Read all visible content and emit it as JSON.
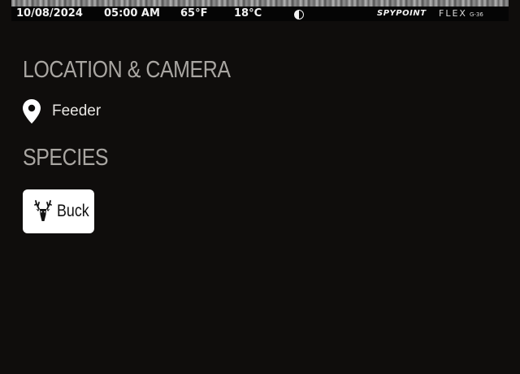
{
  "photo_stamp": {
    "date": "10/08/2024",
    "time": "05:00 AM",
    "temp_f": "65°F",
    "temp_c": "18°C",
    "moon_icon": "moon-phase-icon",
    "brand": "SPYPOINT",
    "model": "FLEX",
    "model_sub": "G-36"
  },
  "location_section": {
    "heading": "LOCATION & CAMERA",
    "icon": "location-pin-icon",
    "camera_name": "Feeder"
  },
  "species_section": {
    "heading": "SPECIES",
    "chips": [
      {
        "label": "Buck",
        "icon": "deer-head-icon"
      }
    ]
  },
  "colors": {
    "background": "#0f0d0c",
    "heading": "#a9a6a2",
    "text": "#e8e6e3",
    "chip_bg": "#ffffff"
  }
}
